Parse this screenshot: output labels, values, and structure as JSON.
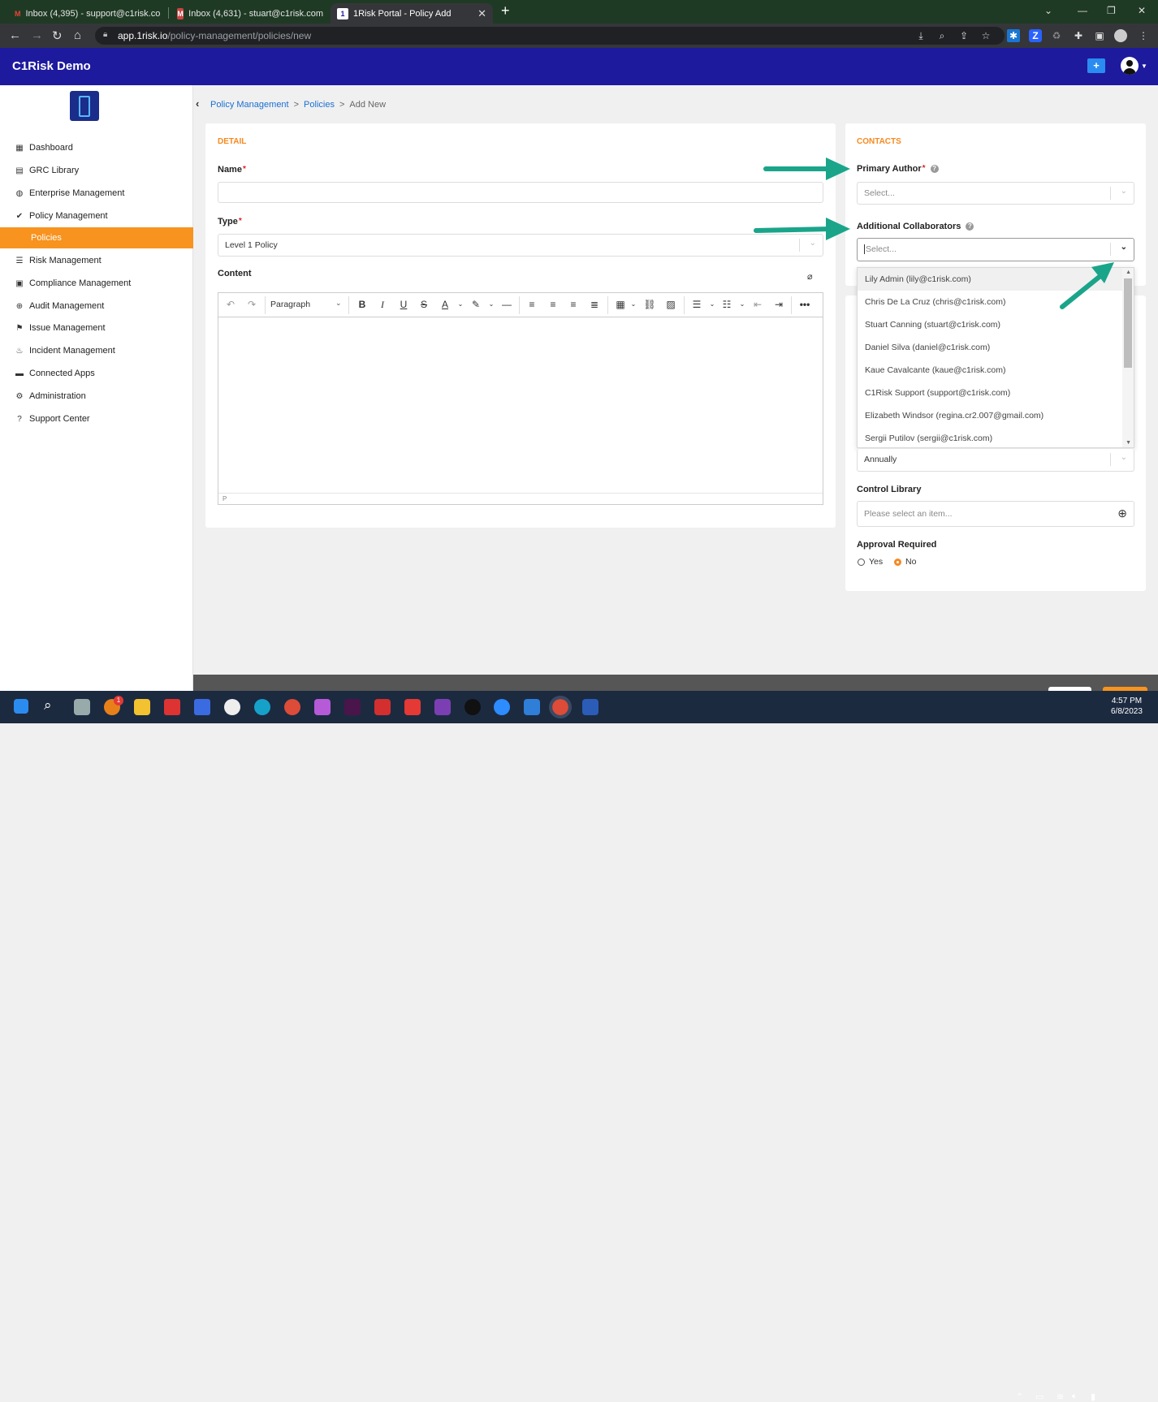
{
  "browser": {
    "tabs": [
      {
        "title": "Inbox (4,395) - support@c1risk.co",
        "favicon": "gmail-icon"
      },
      {
        "title": "Inbox (4,631) - stuart@c1risk.com",
        "favicon": "mail-icon"
      },
      {
        "title": "1Risk Portal - Policy Add",
        "favicon": "c1risk-icon"
      }
    ],
    "url_host": "app.1risk.io",
    "url_path": "/policy-management/policies/new"
  },
  "app": {
    "title": "C1Risk Demo"
  },
  "sidebar": {
    "items": [
      {
        "label": "Dashboard",
        "icon": "grid-icon"
      },
      {
        "label": "GRC Library",
        "icon": "book-icon"
      },
      {
        "label": "Enterprise Management",
        "icon": "globe-icon"
      },
      {
        "label": "Policy Management",
        "icon": "check-double-icon"
      },
      {
        "label": "Policies",
        "icon": ""
      },
      {
        "label": "Risk Management",
        "icon": "list-icon"
      },
      {
        "label": "Compliance Management",
        "icon": "clipboard-check-icon"
      },
      {
        "label": "Audit Management",
        "icon": "crosshair-icon"
      },
      {
        "label": "Issue Management",
        "icon": "flag-icon"
      },
      {
        "label": "Incident Management",
        "icon": "fire-icon"
      },
      {
        "label": "Connected Apps",
        "icon": "box-icon"
      },
      {
        "label": "Administration",
        "icon": "gear-icon"
      },
      {
        "label": "Support Center",
        "icon": "question-circle-icon"
      }
    ]
  },
  "breadcrumb": {
    "level1": "Policy Management",
    "level2": "Policies",
    "current": "Add New"
  },
  "detail": {
    "section": "DETAIL",
    "name_label": "Name",
    "name_value": "",
    "type_label": "Type",
    "type_value": "Level 1 Policy",
    "content_label": "Content",
    "paragraph": "Paragraph",
    "status_path": "P"
  },
  "contacts": {
    "section": "CONTACTS",
    "primary_author_label": "Primary Author",
    "primary_author_placeholder": "Select...",
    "collab_label": "Additional Collaborators",
    "collab_placeholder": "Select...",
    "options": [
      "Lily Admin (lily@c1risk.com)",
      "Chris De La Cruz (chris@c1risk.com)",
      "Stuart Canning (stuart@c1risk.com)",
      "Daniel Silva (daniel@c1risk.com)",
      "Kaue Cavalcante (kaue@c1risk.com)",
      "C1Risk Support (support@c1risk.com)",
      "Elizabeth Windsor (regina.cr2.007@gmail.com)",
      "Sergii Putilov (sergii@c1risk.com)"
    ],
    "review_value": "Annually",
    "control_library_label": "Control Library",
    "control_library_placeholder": "Please select an item...",
    "approval_label": "Approval Required",
    "approval_yes": "Yes",
    "approval_no": "No",
    "approval_selected": "No"
  },
  "annotation": {
    "arrow_color": "#1aa58a"
  },
  "taskbar": {
    "time": "4:57 PM",
    "date": "6/8/2023",
    "badge": "1"
  },
  "colors": {
    "header": "#1e1a9e",
    "accent": "#f7931e",
    "link": "#1a6fd1"
  }
}
